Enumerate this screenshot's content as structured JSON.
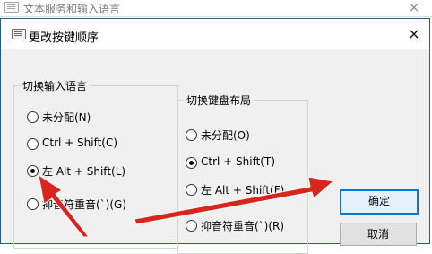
{
  "outer_window": {
    "title": "文本服务和输入语言",
    "close_glyph": "×"
  },
  "dialog": {
    "title": "更改按键顺序",
    "close_glyph": "×"
  },
  "input_language_group": {
    "title": "切换输入语言",
    "options": [
      {
        "label": "未分配(N)",
        "selected": false
      },
      {
        "label": "Ctrl + Shift(C)",
        "selected": false
      },
      {
        "label": "左 Alt + Shift(L)",
        "selected": true
      },
      {
        "label": "抑音符重音(`)(G)",
        "selected": false
      }
    ]
  },
  "keyboard_layout_group": {
    "title": "切换键盘布局",
    "options": [
      {
        "label": "未分配(O)",
        "selected": false
      },
      {
        "label": "Ctrl + Shift(T)",
        "selected": true
      },
      {
        "label": "左 Alt + Shift(F)",
        "selected": false
      },
      {
        "label": "抑音符重音(`)(R)",
        "selected": false
      }
    ]
  },
  "buttons": {
    "ok": "确定",
    "cancel": "取消"
  },
  "colors": {
    "annotation_arrow": "#d9261c",
    "dialog_border": "#2b579a",
    "default_button_border": "#0078d7"
  }
}
